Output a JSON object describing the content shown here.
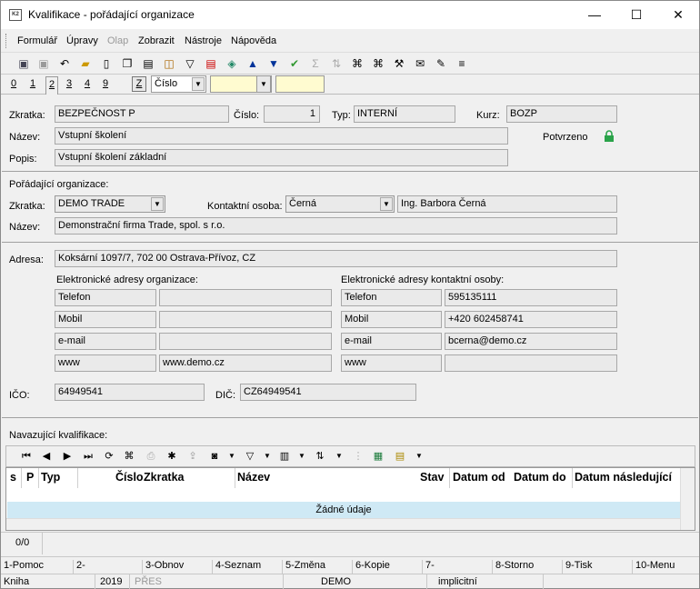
{
  "window": {
    "title": "Kvalifikace - pořádající organizace",
    "app_icon": "K2",
    "minimize": "—",
    "maximize": "☐",
    "close": "✕"
  },
  "menu": [
    "Formulář",
    "Úpravy",
    "Olap",
    "Zobrazit",
    "Nástroje",
    "Nápověda"
  ],
  "tabs": [
    "0",
    "1",
    "2",
    "3",
    "4",
    "9"
  ],
  "sortbar": {
    "z_label": "Z",
    "sort_value": "Číslo"
  },
  "form": {
    "zkratka_label": "Zkratka:",
    "zkratka": "BEZPEČNOST P",
    "cislo_label": "Číslo:",
    "cislo": "1",
    "typ_label": "Typ:",
    "typ": "INTERNÍ",
    "kurz_label": "Kurz:",
    "kurz": "BOZP",
    "nazev_label": "Název:",
    "nazev": "Vstupní školení",
    "potvrzeno_label": "Potvrzeno",
    "popis_label": "Popis:",
    "popis": "Vstupní školení základní"
  },
  "org": {
    "section_label": "Pořádající organizace:",
    "zkratka_label": "Zkratka:",
    "zkratka": "DEMO TRADE",
    "kontakt_label": "Kontaktní osoba:",
    "kontakt": "Černá",
    "kontakt_full": "Ing. Barbora Černá",
    "nazev_label": "Název:",
    "nazev": "Demonstrační firma Trade, spol. s r.o."
  },
  "address": {
    "label": "Adresa:",
    "value": "Koksární 1097/7, 702 00  Ostrava-Přívoz, CZ",
    "org_heading": "Elektronické adresy organizace:",
    "contact_heading": "Elektronické adresy kontaktní osoby:",
    "org_rows": [
      [
        "Telefon",
        ""
      ],
      [
        "Mobil",
        ""
      ],
      [
        "e-mail",
        ""
      ],
      [
        "www",
        "www.demo.cz"
      ]
    ],
    "contact_rows": [
      [
        "Telefon",
        "595135111"
      ],
      [
        "Mobil",
        "+420 602458741"
      ],
      [
        "e-mail",
        "bcerna@demo.cz"
      ],
      [
        "www",
        ""
      ]
    ],
    "ico_label": "IČO:",
    "ico": "64949541",
    "dic_label": "DIČ:",
    "dic": "CZ64949541"
  },
  "grid": {
    "title": "Navazující kvalifikace:",
    "columns": [
      "s",
      "P",
      "Typ",
      "Číslo",
      "Zkratka",
      "Název",
      "Stav",
      "Datum od",
      "Datum do",
      "Datum následující"
    ],
    "empty": "Žádné údaje",
    "count": "0/0"
  },
  "fkeys": [
    "1-Pomoc",
    "2-",
    "3-Obnov",
    "4-Seznam",
    "5-Změna",
    "6-Kopie",
    "7-",
    "8-Storno",
    "9-Tisk",
    "10-Menu"
  ],
  "statusbar": [
    "Kniha",
    "2019",
    "PŘES",
    "DEMO",
    "implicitní"
  ],
  "colors": {
    "accent_green": "#2aa34a",
    "lookup_yellow": "#fffbd0",
    "empty_row": "#cfe9f5"
  }
}
